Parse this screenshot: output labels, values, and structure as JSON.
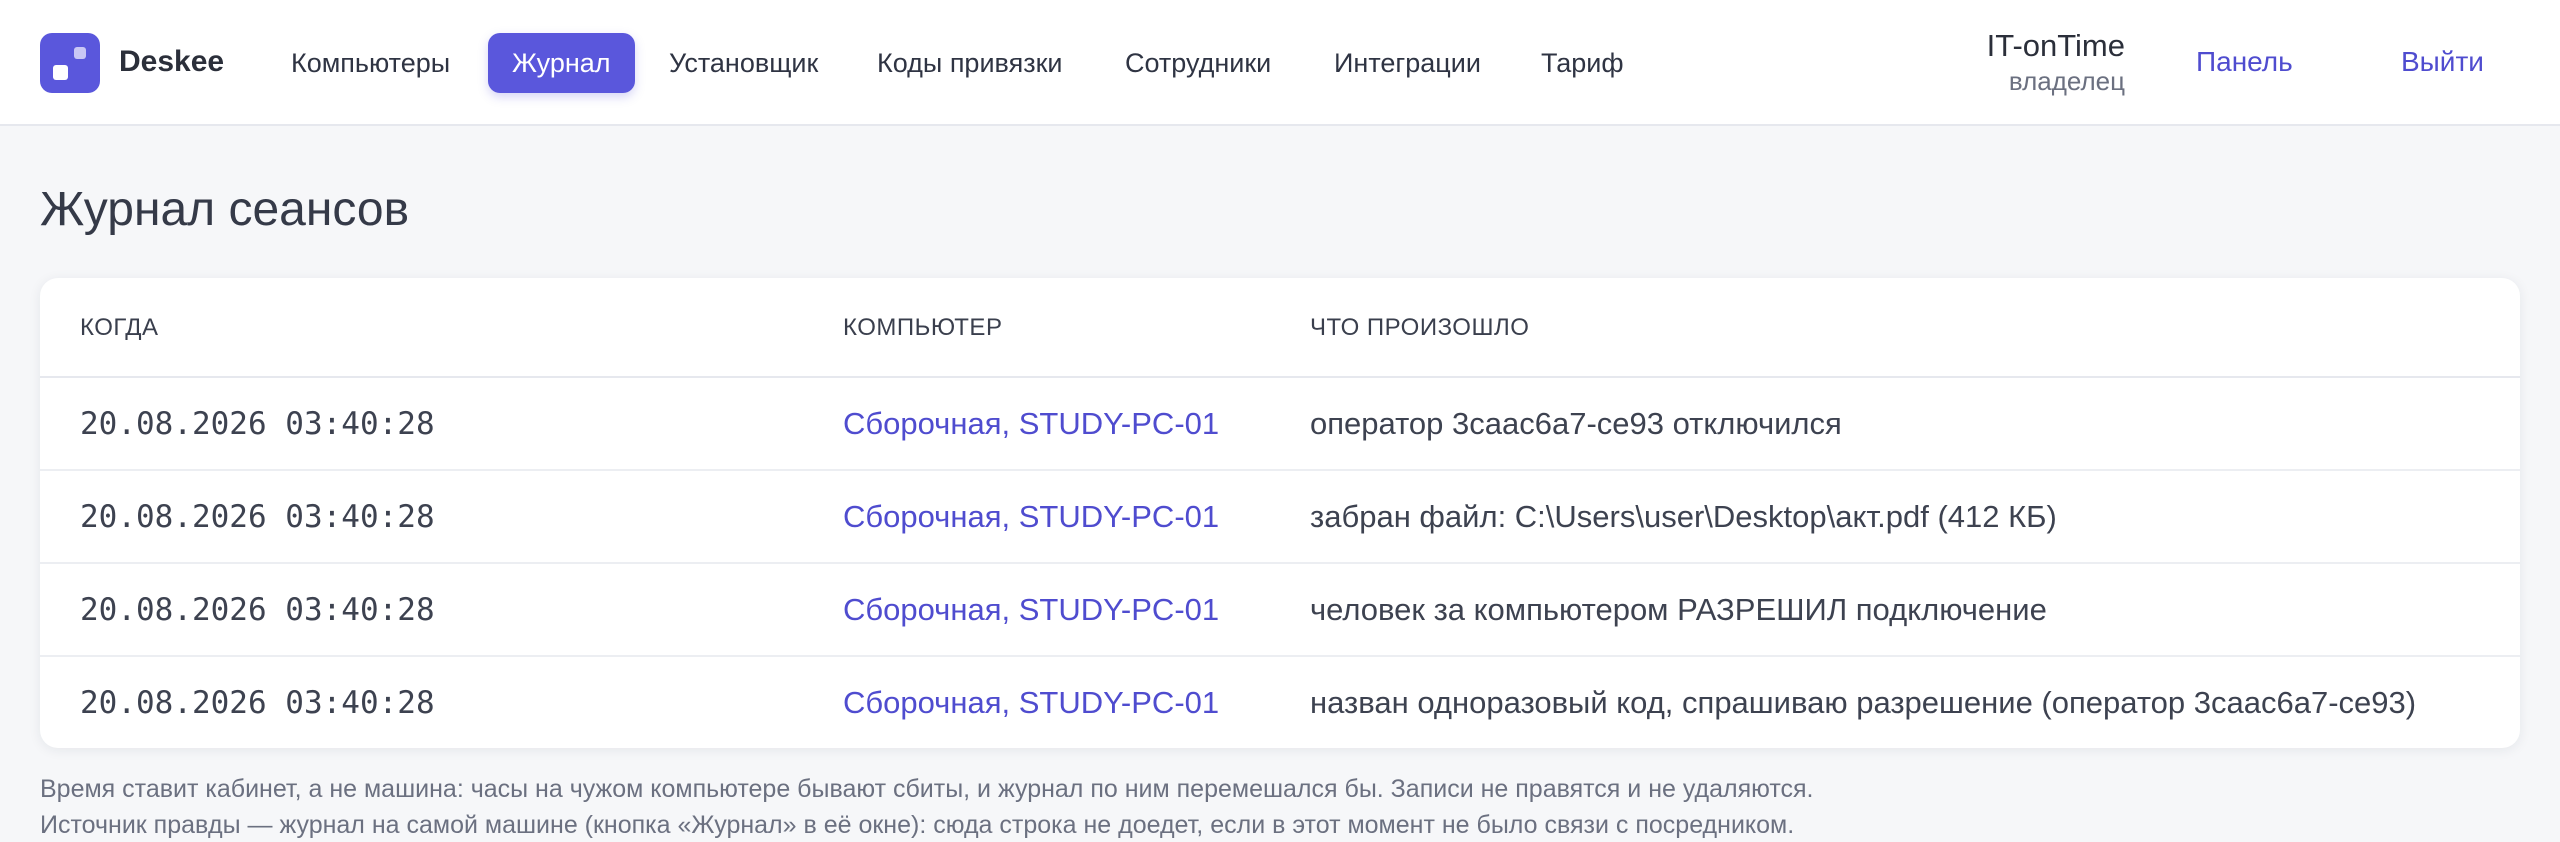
{
  "app": {
    "brand": "Deskee"
  },
  "nav": {
    "items": [
      {
        "label": "Компьютеры"
      },
      {
        "label": "Журнал"
      },
      {
        "label": "Установщик"
      },
      {
        "label": "Коды привязки"
      },
      {
        "label": "Сотрудники"
      },
      {
        "label": "Интеграции"
      },
      {
        "label": "Тариф"
      }
    ],
    "active": "Журнал"
  },
  "account": {
    "org": "IT-onTime",
    "role": "владелец",
    "panel_label": "Панель",
    "logout_label": "Выйти"
  },
  "page": {
    "title": "Журнал сеансов"
  },
  "table": {
    "columns": [
      "КОГДА",
      "КОМПЬЮТЕР",
      "ЧТО ПРОИЗОШЛО"
    ],
    "rows": [
      {
        "time": "20.08.2026 03:40:28",
        "computer": "Сборочная, STUDY-PC-01",
        "event": "оператор 3caac6a7-ce93 отключился"
      },
      {
        "time": "20.08.2026 03:40:28",
        "computer": "Сборочная, STUDY-PC-01",
        "event": "забран файл: C:\\Users\\user\\Desktop\\акт.pdf (412 КБ)"
      },
      {
        "time": "20.08.2026 03:40:28",
        "computer": "Сборочная, STUDY-PC-01",
        "event": "человек за компьютером РАЗРЕШИЛ подключение"
      },
      {
        "time": "20.08.2026 03:40:28",
        "computer": "Сборочная, STUDY-PC-01",
        "event": "назван одноразовый код, спрашиваю разрешение (оператор 3caac6a7-ce93)"
      }
    ]
  },
  "notes": [
    "Время ставит кабинет, а не машина: часы на чужом компьютере бывают сбиты, и журнал по ним перемешался бы. Записи не правятся и не удаляются.",
    "Источник правды — журнал на самой машине (кнопка «Журнал» в её окне): сюда строка не доедет, если в этот момент не было связи с посредником."
  ],
  "colors": {
    "accent": "#5a57dc",
    "link": "#4f4ccf",
    "background": "#f6f7f9"
  }
}
